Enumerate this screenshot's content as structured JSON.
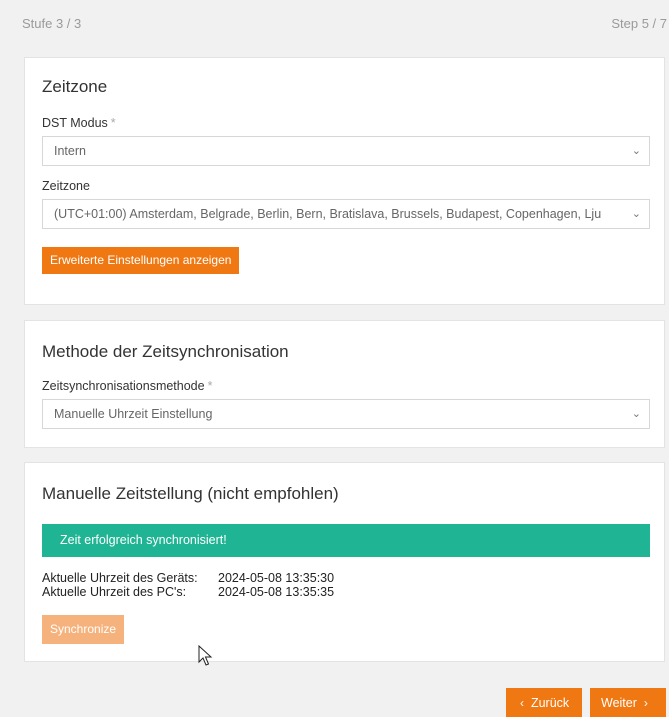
{
  "header": {
    "step_left": "Stufe 3 / 3",
    "step_right": "Step 5 / 7"
  },
  "timezone_card": {
    "title": "Zeitzone",
    "dst_label": "DST Modus",
    "dst_required": "*",
    "dst_value": "Intern",
    "tz_label": "Zeitzone",
    "tz_value": "(UTC+01:00) Amsterdam, Belgrade, Berlin, Bern, Bratislava, Brussels, Budapest, Copenhagen, Lju",
    "advanced_button": "Erweiterte Einstellungen anzeigen"
  },
  "sync_card": {
    "title": "Methode der Zeitsynchronisation",
    "method_label": "Zeitsynchronisationsmethode",
    "method_required": "*",
    "method_value": "Manuelle Uhrzeit Einstellung"
  },
  "manual_card": {
    "title": "Manuelle Zeitstellung (nicht empfohlen)",
    "alert": "Zeit erfolgreich synchronisiert!",
    "device_time_label": "Aktuelle Uhrzeit des Geräts:",
    "device_time_value": "2024-05-08 13:35:30",
    "pc_time_label": "Aktuelle Uhrzeit des PC's:",
    "pc_time_value": "2024-05-08 13:35:35",
    "sync_button": "Synchronize"
  },
  "footer": {
    "back_label": "Zurück",
    "next_label": "Weiter"
  },
  "colors": {
    "accent": "#f07813",
    "success": "#1fb493",
    "disabled_accent": "#f6b27c"
  },
  "icons": {
    "dropdown": "chevron-down-icon",
    "back": "chevron-left-icon",
    "next": "chevron-right-icon",
    "cursor": "mouse-pointer-icon"
  }
}
